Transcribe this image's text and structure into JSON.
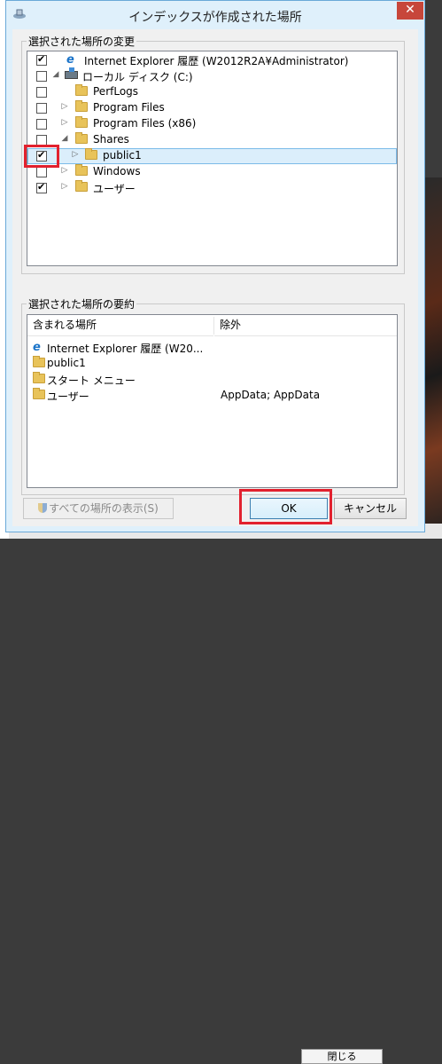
{
  "window": {
    "title": "インデックスが作成された場所",
    "close_glyph": "✕"
  },
  "change_group": {
    "legend": "選択された場所の変更",
    "items": [
      {
        "label": "Internet Explorer 履歴 (W2012R2A¥Administrator)",
        "checked": true
      },
      {
        "label": "ローカル ディスク (C:)",
        "checked": false
      },
      {
        "label": "PerfLogs",
        "checked": false
      },
      {
        "label": "Program Files",
        "checked": false
      },
      {
        "label": "Program Files (x86)",
        "checked": false
      },
      {
        "label": "Shares",
        "checked": false
      },
      {
        "label": "public1",
        "checked": true,
        "selected": true
      },
      {
        "label": "Windows",
        "checked": false
      },
      {
        "label": "ユーザー",
        "checked": true
      }
    ]
  },
  "summary_group": {
    "legend": "選択された場所の要約",
    "columns": [
      "含まれる場所",
      "除外"
    ],
    "rows": [
      {
        "included": "Internet Explorer 履歴 (W20...",
        "excluded": ""
      },
      {
        "included": "public1",
        "excluded": ""
      },
      {
        "included": "スタート メニュー",
        "excluded": ""
      },
      {
        "included": "ユーザー",
        "excluded": "AppData; AppData"
      }
    ]
  },
  "buttons": {
    "show_all": "すべての場所の表示(S)",
    "ok": "OK",
    "cancel": "キャンセル"
  },
  "background": {
    "button_label": "閉じる"
  },
  "colors": {
    "highlight": "#e2212e",
    "selection": "#dbeefb",
    "title_bg": "#dff0fb"
  }
}
